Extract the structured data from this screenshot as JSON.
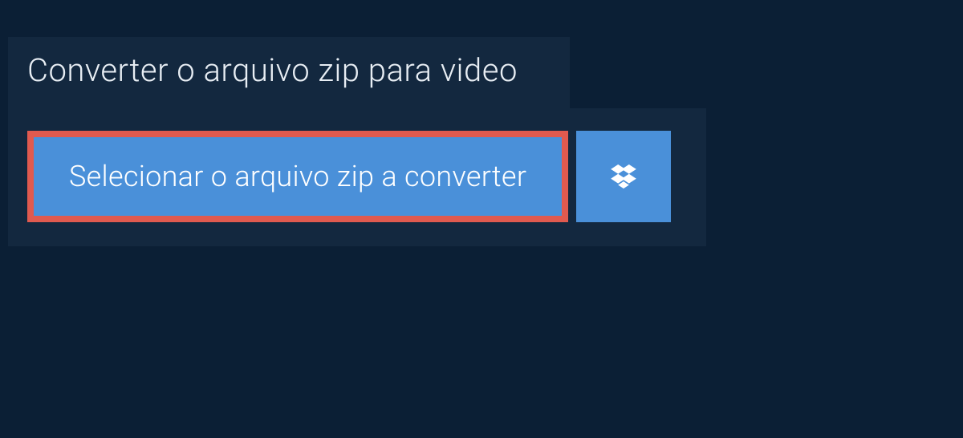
{
  "header": {
    "title": "Converter o arquivo zip para video"
  },
  "actions": {
    "select_label": "Selecionar o arquivo zip a converter",
    "dropbox_icon": "dropbox"
  },
  "colors": {
    "background": "#0b1f35",
    "panel": "#13283f",
    "button": "#4a90d9",
    "highlight_border": "#e05a4f",
    "text": "#ffffff"
  }
}
